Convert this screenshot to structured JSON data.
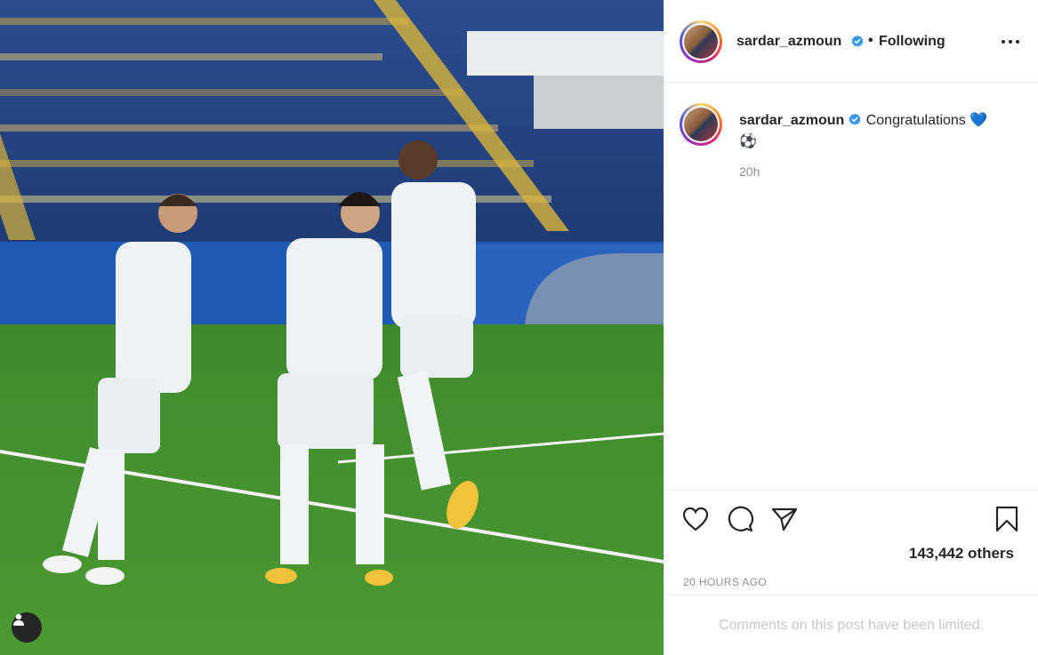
{
  "post": {
    "image_alt": "Football players celebrating on the pitch"
  },
  "header": {
    "username": "sardar_azmoun",
    "separator": "•",
    "follow_state": "Following",
    "more_icon": "more-horizontal-icon"
  },
  "caption": {
    "username": "sardar_azmoun",
    "text": "Congratulations",
    "emoji_heart": "💙",
    "emoji_ball": "⚽",
    "time": "20h"
  },
  "actions": {
    "like_icon": "heart-icon",
    "comment_icon": "comment-icon",
    "share_icon": "send-icon",
    "save_icon": "bookmark-icon",
    "likes_text": "143,442 others",
    "timestamp": "20 HOURS AGO"
  },
  "comments": {
    "limited_text": "Comments on this post have been limited."
  },
  "colors": {
    "verified_blue": "#3897f0",
    "muted_text": "#8e8e8e",
    "border": "#efefef"
  }
}
